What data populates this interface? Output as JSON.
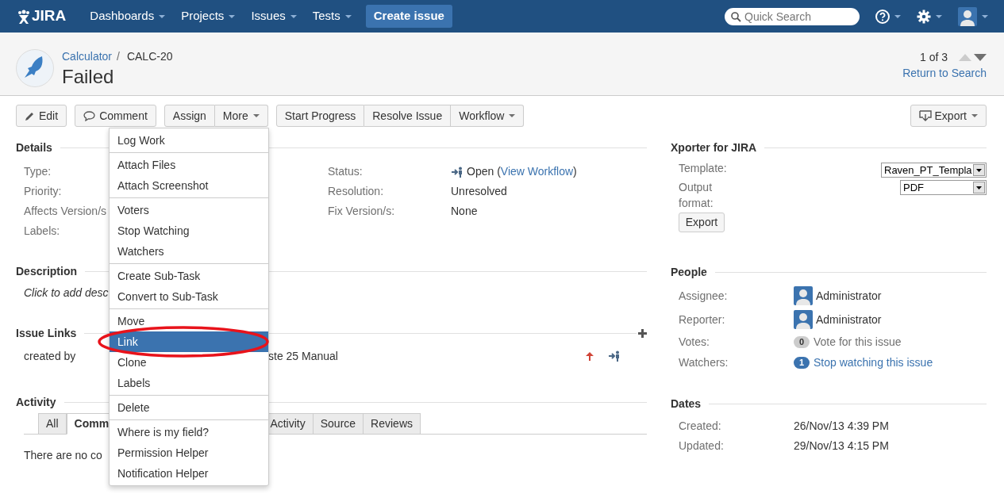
{
  "header": {
    "logo": "JIRA",
    "nav": [
      {
        "label": "Dashboards"
      },
      {
        "label": "Projects"
      },
      {
        "label": "Issues"
      },
      {
        "label": "Tests"
      }
    ],
    "create_button": "Create issue",
    "search": {
      "placeholder": "Quick Search"
    }
  },
  "issue": {
    "project": "Calculator",
    "separator": "/",
    "key": "CALC-20",
    "title": "Failed",
    "pager": "1 of 3",
    "prev_disabled": true,
    "next_disabled": false,
    "return_link": "Return to Search"
  },
  "toolbar": {
    "groups": [
      {
        "buttons": [
          {
            "label": "Edit",
            "kind": "edit"
          }
        ]
      },
      {
        "buttons": [
          {
            "label": "Comment",
            "kind": "comment"
          }
        ]
      },
      {
        "buttons": [
          {
            "label": "Assign",
            "kind": "plain"
          },
          {
            "label": "More",
            "kind": "dropdown"
          }
        ]
      },
      {
        "buttons": [
          {
            "label": "Start Progress",
            "kind": "plain"
          },
          {
            "label": "Resolve Issue",
            "kind": "plain"
          },
          {
            "label": "Workflow",
            "kind": "dropdown"
          }
        ]
      }
    ],
    "export_button": "Export"
  },
  "more_menu": {
    "sections": [
      [
        {
          "label": "Log Work",
          "selected": false
        }
      ],
      [
        {
          "label": "Attach Files",
          "selected": false
        },
        {
          "label": "Attach Screenshot",
          "selected": false
        }
      ],
      [
        {
          "label": "Voters",
          "selected": false
        },
        {
          "label": "Stop Watching",
          "selected": false
        },
        {
          "label": "Watchers",
          "selected": false
        }
      ],
      [
        {
          "label": "Create Sub-Task",
          "selected": false
        },
        {
          "label": "Convert to Sub-Task",
          "selected": false
        }
      ],
      [
        {
          "label": "Move",
          "selected": false
        },
        {
          "label": "Link",
          "selected": true
        },
        {
          "label": "Clone",
          "selected": false
        },
        {
          "label": "Labels",
          "selected": false
        }
      ],
      [
        {
          "label": "Delete",
          "selected": false
        }
      ],
      [
        {
          "label": "Where is my field?",
          "selected": false
        },
        {
          "label": "Permission Helper",
          "selected": false
        },
        {
          "label": "Notification Helper",
          "selected": false
        }
      ]
    ],
    "highlight_circle": true
  },
  "details": {
    "title": "Details",
    "left_fields": [
      {
        "label": "Type:"
      },
      {
        "label": "Priority:"
      },
      {
        "label": "Affects Version/s"
      },
      {
        "label": "Labels:"
      }
    ],
    "right_fields": [
      {
        "label": "Status:",
        "kind": "status",
        "value": "Open (",
        "link": "View Workflow",
        "after": ")"
      },
      {
        "label": "Resolution:",
        "kind": "text",
        "value": "Unresolved"
      },
      {
        "label": "Fix Version/s:",
        "kind": "text",
        "value": "None"
      }
    ]
  },
  "description": {
    "title": "Description",
    "text": "Click to add desc"
  },
  "issue_links": {
    "title": "Issue Links",
    "rows": [
      {
        "relation": "created by",
        "summary": "ste 25 Manual"
      }
    ]
  },
  "activity": {
    "title": "Activity",
    "tabs_left": [
      {
        "label": "All",
        "selected": false
      },
      {
        "label": "Comm",
        "selected": true
      }
    ],
    "tabs_right": [
      {
        "label": "Activity",
        "selected": false
      },
      {
        "label": "Source",
        "selected": false
      },
      {
        "label": "Reviews",
        "selected": false
      }
    ],
    "empty_text": "There are no co"
  },
  "xporter": {
    "title": "Xporter for JIRA",
    "template_label": "Template:",
    "template_value": "Raven_PT_Templa",
    "format_label": "Output format:",
    "format_value": "PDF",
    "button": "Export"
  },
  "people": {
    "title": "People",
    "rows": [
      {
        "label": "Assignee:",
        "kind": "user",
        "value": "Administrator"
      },
      {
        "label": "Reporter:",
        "kind": "user",
        "value": "Administrator"
      },
      {
        "label": "Votes:",
        "kind": "count",
        "count": "0",
        "active": false,
        "value": "Vote for this issue"
      },
      {
        "label": "Watchers:",
        "kind": "count",
        "count": "1",
        "active": true,
        "value": "Stop watching this issue"
      }
    ]
  },
  "dates": {
    "title": "Dates",
    "rows": [
      {
        "label": "Created:",
        "value": "26/Nov/13 4:39 PM"
      },
      {
        "label": "Updated:",
        "value": "29/Nov/13 4:15 PM"
      }
    ]
  }
}
